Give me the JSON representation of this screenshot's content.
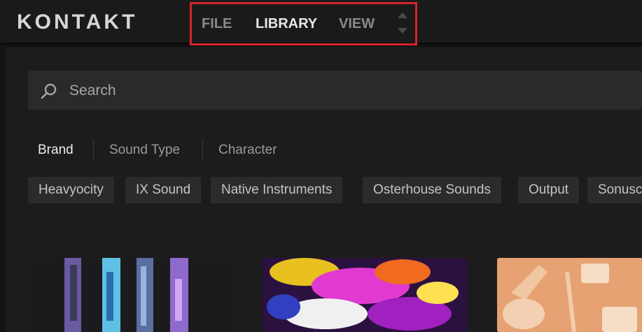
{
  "app": {
    "logo_text": "KONTAKT"
  },
  "menu": {
    "items": [
      {
        "label": "FILE",
        "active": false
      },
      {
        "label": "LIBRARY",
        "active": true
      },
      {
        "label": "VIEW",
        "active": false
      }
    ],
    "highlight_color": "#d6232a"
  },
  "search": {
    "placeholder": "Search"
  },
  "filter_tabs": [
    {
      "label": "Brand",
      "active": true
    },
    {
      "label": "Sound Type",
      "active": false
    },
    {
      "label": "Character",
      "active": false
    }
  ],
  "brands": [
    "Heavyocity",
    "IX Sound",
    "Native Instruments",
    "Osterhouse Sounds",
    "Output",
    "Sonuscore"
  ],
  "cards": [
    {
      "name": "card-abstract-stripes"
    },
    {
      "name": "card-neon-colors"
    },
    {
      "name": "card-orange-instruments"
    }
  ]
}
